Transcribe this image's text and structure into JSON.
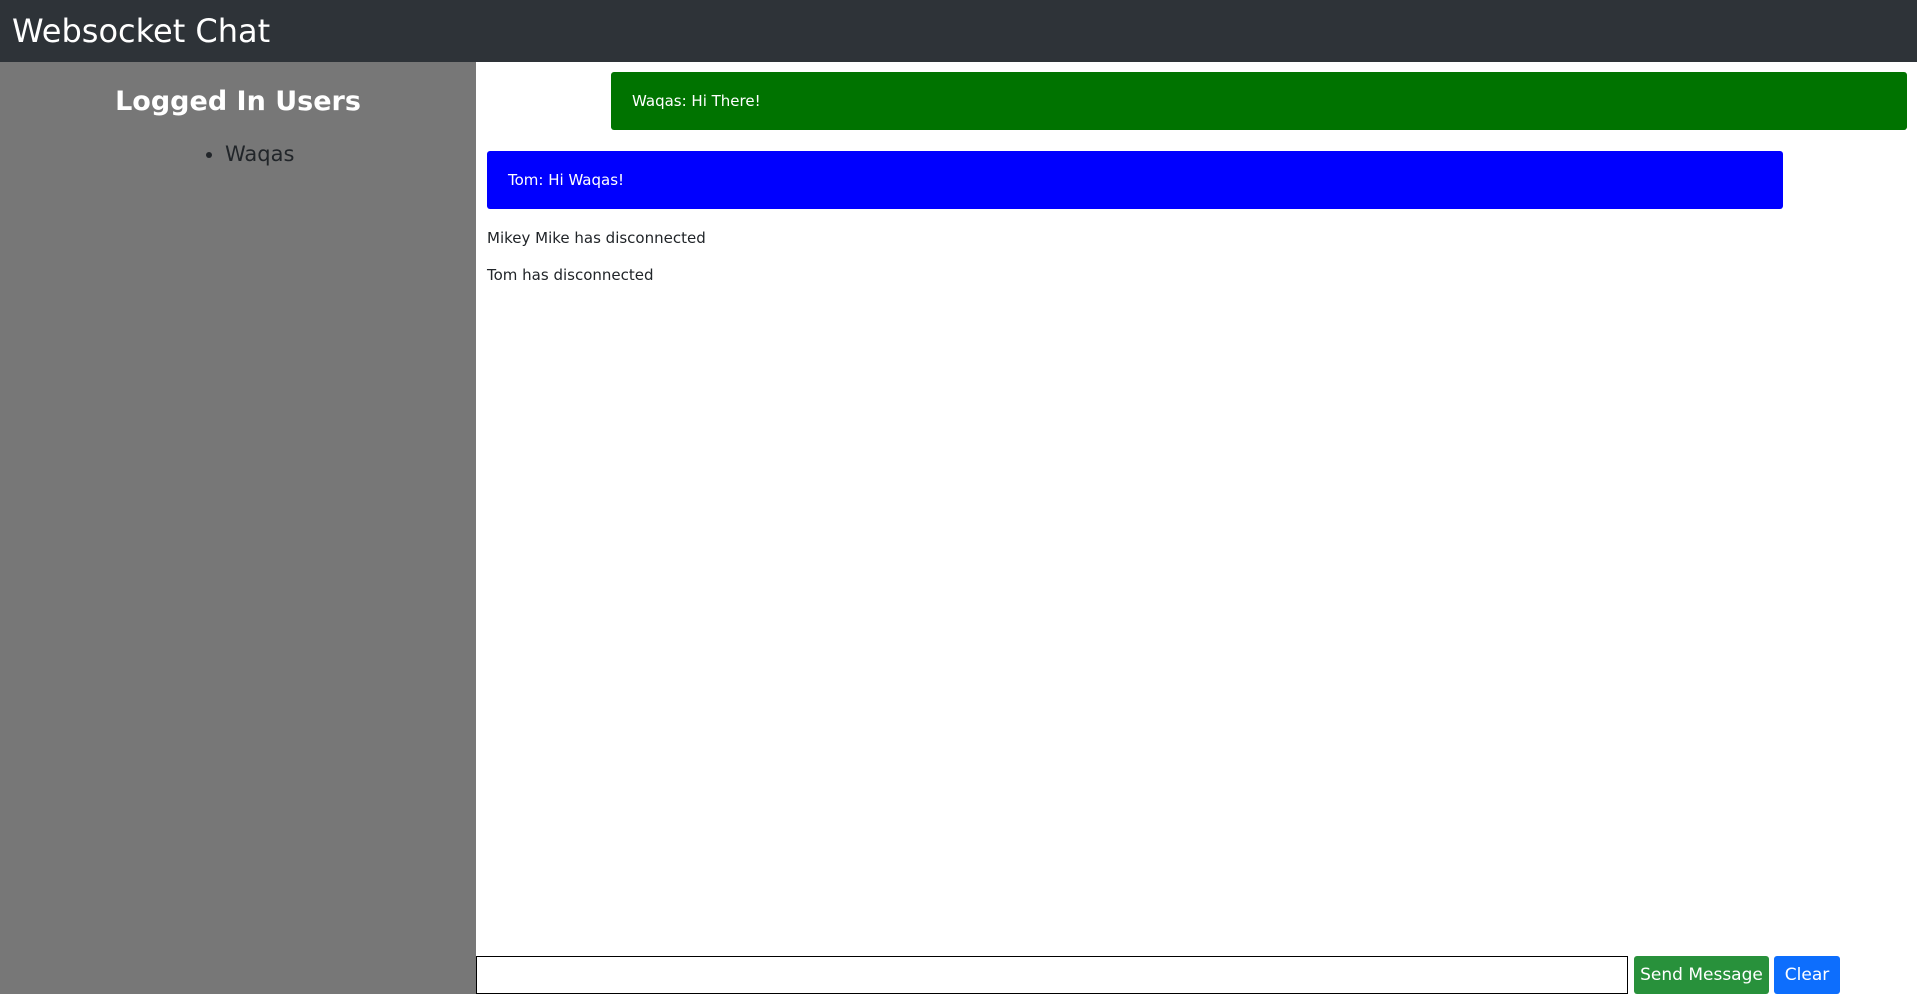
{
  "header": {
    "title": "Websocket Chat"
  },
  "sidebar": {
    "title": "Logged In Users",
    "users": [
      "Waqas"
    ]
  },
  "messages": [
    {
      "text": "Waqas: Hi There!",
      "kind": "self",
      "color": "#007300"
    },
    {
      "text": "Tom: Hi Waqas!",
      "kind": "other",
      "color": "#0000ff"
    }
  ],
  "status_messages": [
    "Mikey Mike has disconnected",
    "Tom has disconnected"
  ],
  "composer": {
    "input_value": "",
    "send_label": "Send Message",
    "clear_label": "Clear"
  },
  "colors": {
    "navbar": "#2e3338",
    "sidebar": "#777777",
    "send_button": "#28913b",
    "clear_button": "#0d6efd"
  }
}
